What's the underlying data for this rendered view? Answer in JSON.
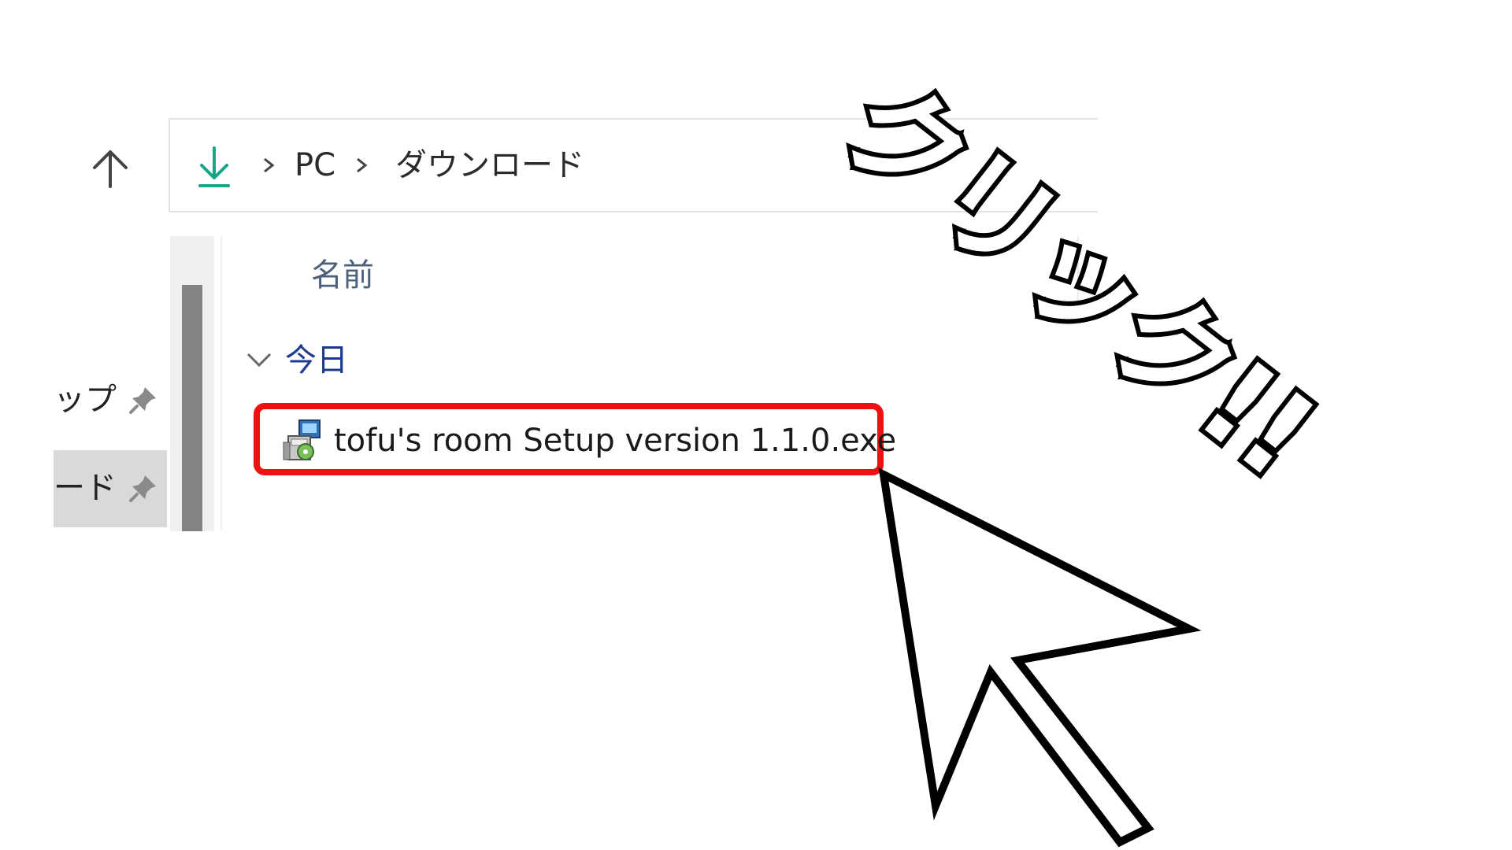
{
  "address_bar": {
    "icon": "download-arrow-icon",
    "breadcrumb": [
      "PC",
      "ダウンロード"
    ]
  },
  "navigation_pane": {
    "items": [
      {
        "label": "ップ",
        "pinned": true,
        "selected": false
      },
      {
        "label": "ード",
        "pinned": true,
        "selected": true
      }
    ]
  },
  "file_list": {
    "column_header": "名前",
    "group": {
      "label": "今日",
      "expanded": true
    },
    "files": [
      {
        "name": "tofu's room Setup version 1.1.0.exe",
        "icon": "installer-icon"
      }
    ]
  },
  "annotation": {
    "text": "クリック!!",
    "highlight_color": "#ee1111"
  }
}
